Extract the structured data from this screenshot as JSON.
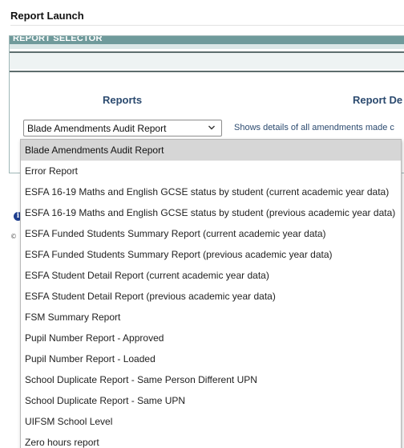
{
  "page": {
    "title": "Report Launch"
  },
  "selector": {
    "header_label": "REPORT SELECTOR",
    "column_reports": "Reports",
    "column_details": "Report De",
    "selected_report": "Blade Amendments Audit Report",
    "description": "Shows details of all amendments made c"
  },
  "icons": {
    "info_glyph": "i",
    "copyright_glyph": "©"
  },
  "dropdown": {
    "options": [
      "Blade Amendments Audit Report",
      "Error Report",
      "ESFA 16-19 Maths and English GCSE status by student (current academic year data)",
      "ESFA 16-19 Maths and English GCSE status by student (previous academic year data)",
      "ESFA Funded Students Summary Report (current academic year data)",
      "ESFA Funded Students Summary Report (previous academic year data)",
      "ESFA Student Detail Report (current academic year data)",
      "ESFA Student Detail Report (previous academic year data)",
      "FSM Summary Report",
      "Pupil Number Report - Approved",
      "Pupil Number Report - Loaded",
      "School Duplicate Report - Same Person Different UPN",
      "School Duplicate Report - Same UPN",
      "UIFSM School Level",
      "Zero hours report"
    ],
    "selected_index": 0
  },
  "colors": {
    "panel_header": "#6f9a9b",
    "heading_text": "#2b4a6f",
    "selected_option_bg": "#d6d6d6"
  }
}
